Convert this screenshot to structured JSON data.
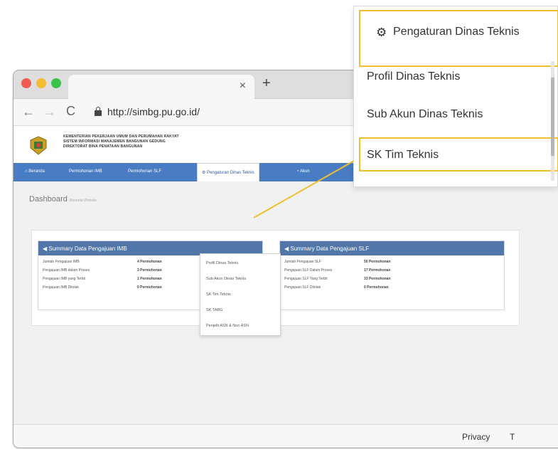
{
  "browser": {
    "tab_close": "×",
    "new_tab": "+",
    "back_glyph": "←",
    "forward_glyph": "→",
    "reload_glyph": "C",
    "url": "http://simbg.pu.go.id/"
  },
  "site": {
    "header_lines": [
      "KEMENTERIAN PEKERJAAN UMUM DAN PERUMAHAN RAKYAT",
      "SISTEM INFORMASI MANAJEMEN BANGUNAN GEDUNG",
      "DIREKTORAT BINA PENATAAN BANGUNAN"
    ],
    "menu": [
      {
        "label": "Beranda"
      },
      {
        "label": "Permohonan IMB"
      },
      {
        "label": "Permohonan SLF"
      },
      {
        "label": "Pengaturan Dinas Teknis"
      },
      {
        "label": "Akun"
      }
    ],
    "dropdown": [
      "Profil Dinas Teknis",
      "Sub Akun Dinas Teknis",
      "SK Tim Teknis",
      "SK TABG",
      "Penjelit ASN & Non ASN"
    ],
    "dashboard_title": "Dashboard",
    "dashboard_subtitle": "Beranda Website",
    "panels": [
      {
        "title": "Summary Data Pengajuan IMB",
        "rows": [
          {
            "label": "Jumlah Pengajuan IMB",
            "value": "4 Permohonan"
          },
          {
            "label": "Pengajuan IMB dalam Proses",
            "value": "3 Permohonan"
          },
          {
            "label": "Pengajuan IMB yang Terbit",
            "value": "1 Permohonan"
          },
          {
            "label": "Pengajuan IMB Ditolak",
            "value": "0 Permohonan"
          }
        ]
      },
      {
        "title": "Summary Data Pengajuan SLF",
        "rows": [
          {
            "label": "Jumlah Pengajuan SLF",
            "value": "50 Permohonan"
          },
          {
            "label": "Pengajuan SLF Dalam Proses",
            "value": "17 Permohonan"
          },
          {
            "label": "Pengajuan SLF Yang Terbit",
            "value": "33 Permohonan"
          },
          {
            "label": "Pengajuan SLF Ditolak",
            "value": "0 Permohonan"
          }
        ]
      }
    ],
    "privacy": "Privacy",
    "privacy_more": "T"
  },
  "callout": {
    "icon": "gear-icon",
    "icon_glyph": "⚙",
    "header": "Pengaturan Dinas Teknis",
    "items": [
      "Profil Dinas Teknis",
      "Sub Akun Dinas Teknis",
      "SK Tim Teknis"
    ]
  },
  "colors": {
    "menubar": "#4a7cc4",
    "panel_header": "#5276a8",
    "highlight": "#f0bf2f",
    "dot_red": "#f05a4f",
    "dot_yellow": "#f5bc32",
    "dot_green": "#3bc24b"
  }
}
